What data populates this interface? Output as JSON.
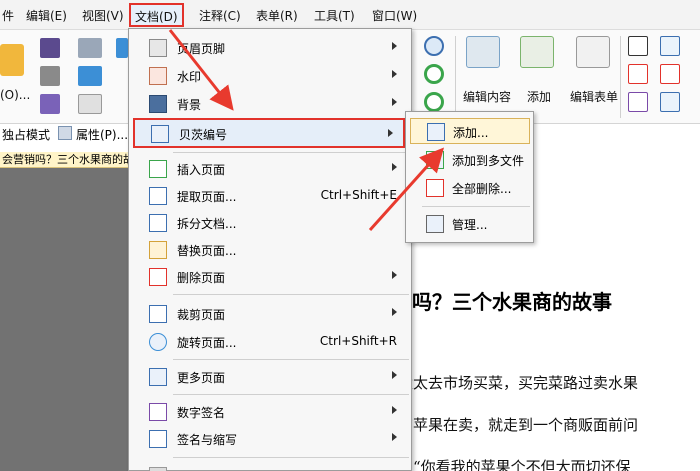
{
  "menubar": {
    "items": [
      {
        "label": "件"
      },
      {
        "label": "编辑(E)"
      },
      {
        "label": "视图(V)"
      },
      {
        "label": "文档(D)"
      },
      {
        "label": "注释(C)"
      },
      {
        "label": "表单(R)"
      },
      {
        "label": "工具(T)"
      },
      {
        "label": "窗口(W)"
      }
    ]
  },
  "ribbon": {
    "left_label": "(O)...",
    "edit_content": "编辑内容",
    "add": "添加",
    "edit_form": "编辑表单"
  },
  "toolrow": {
    "solo_mode": "独占模式",
    "properties": "属性(P)..."
  },
  "doc_tab": {
    "title": "会营销吗？三个水果商的故"
  },
  "document": {
    "title": "营销吗？三个水果商的故事",
    "line1": "太太去市场买菜，买完菜路过卖水果",
    "line2": "有苹果在卖，就走到一个商贩面前问",
    "line3": "：“你看我的苹果个不但大而切还保"
  },
  "menu": {
    "items": [
      {
        "label": "页眉页脚",
        "shortcut": ""
      },
      {
        "label": "水印",
        "shortcut": ""
      },
      {
        "label": "背景",
        "shortcut": ""
      },
      {
        "label": "贝茨编号",
        "shortcut": ""
      },
      {
        "label": "插入页面",
        "shortcut": ""
      },
      {
        "label": "提取页面...",
        "shortcut": "Ctrl+Shift+E"
      },
      {
        "label": "拆分文档...",
        "shortcut": ""
      },
      {
        "label": "替换页面...",
        "shortcut": ""
      },
      {
        "label": "删除页面",
        "shortcut": ""
      },
      {
        "label": "裁剪页面",
        "shortcut": ""
      },
      {
        "label": "旋转页面...",
        "shortcut": "Ctrl+Shift+R"
      },
      {
        "label": "更多页面",
        "shortcut": ""
      },
      {
        "label": "数字签名",
        "shortcut": ""
      },
      {
        "label": "签名与缩写",
        "shortcut": ""
      }
    ]
  },
  "submenu": {
    "items": [
      {
        "label": "添加..."
      },
      {
        "label": "添加到多文件"
      },
      {
        "label": "全部删除..."
      },
      {
        "label": "管理..."
      }
    ]
  },
  "colors": {
    "highlight_border": "#e2322b",
    "arrow": "#e83a2e",
    "menu_bg": "#f7f7f7",
    "hover_bg": "#e5eef9",
    "submenu_hover": "#fff6d8"
  }
}
